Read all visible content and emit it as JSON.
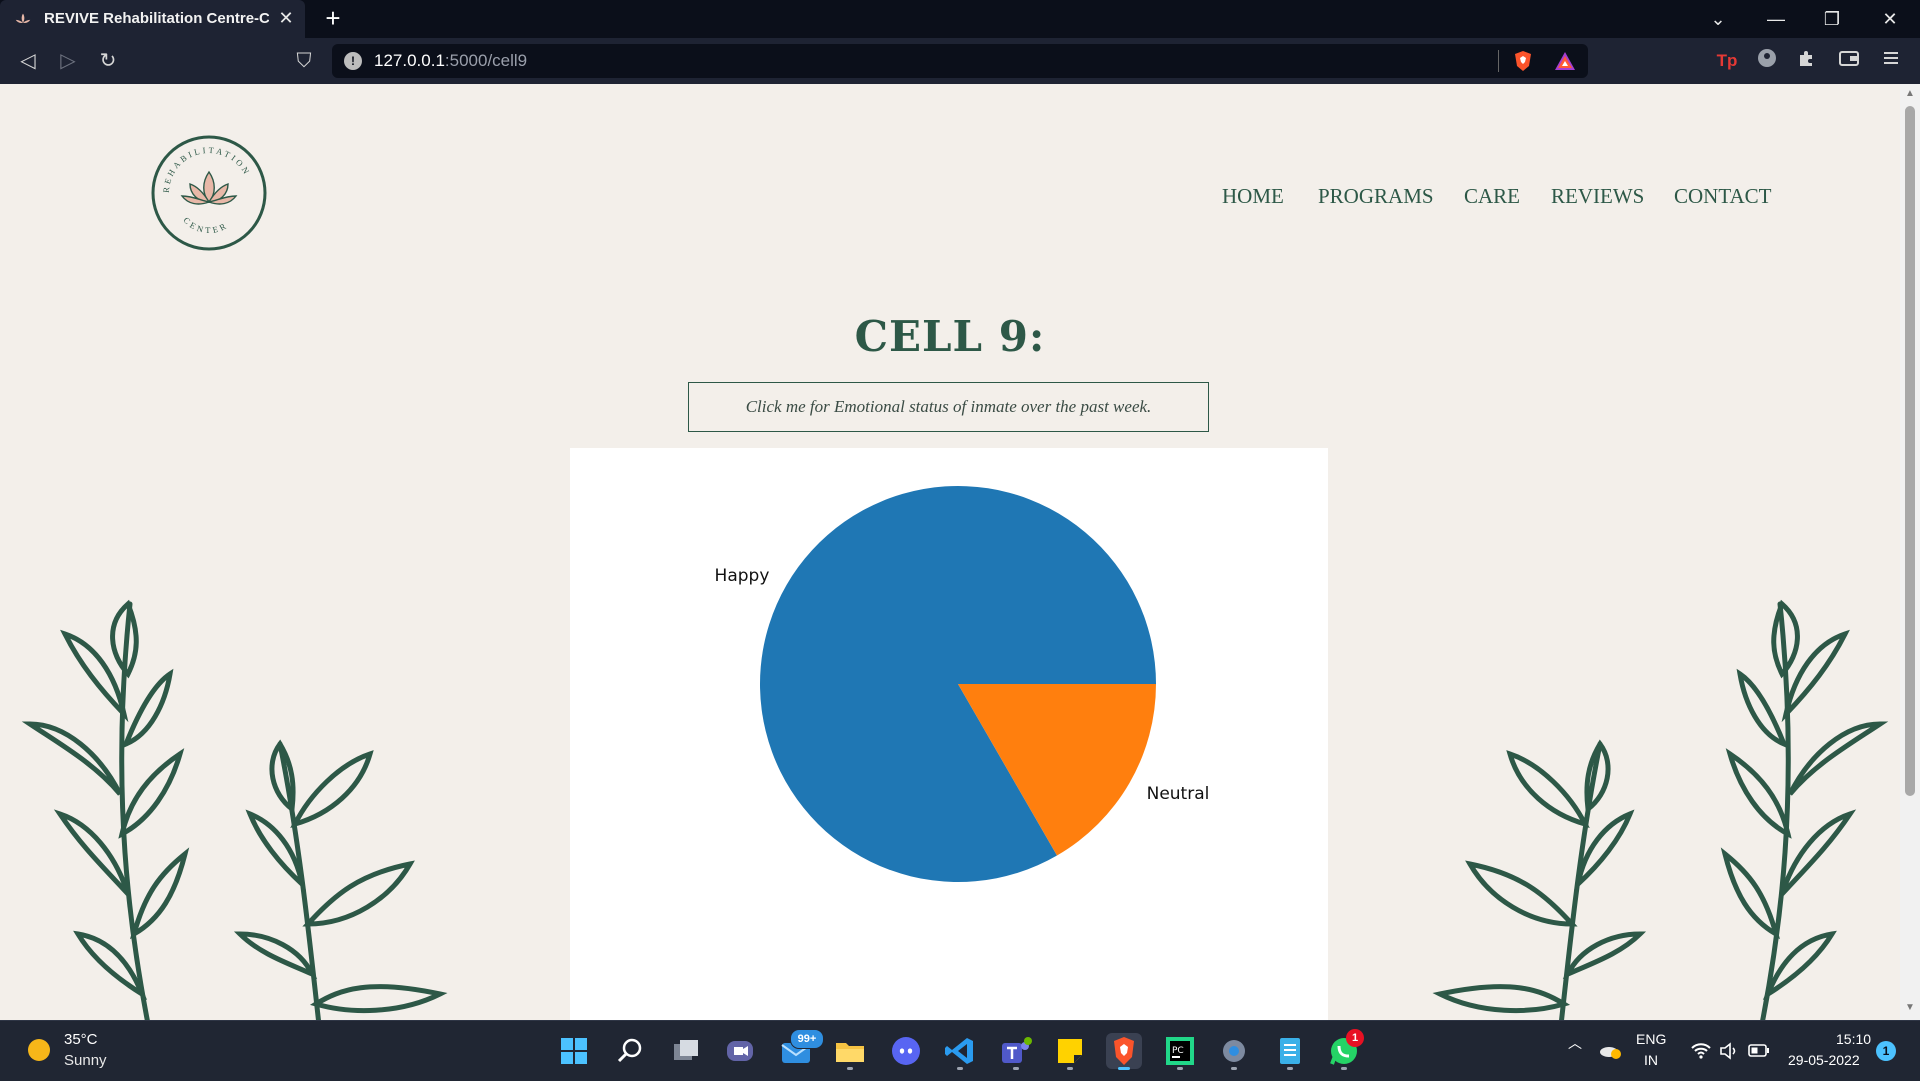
{
  "browser": {
    "tab_title": "REVIVE Rehabilitation Centre-CEL",
    "tab_close": "✕",
    "new_tab": "+",
    "url_host": "127.0.0.1",
    "url_path": ":5000/cell9",
    "url_info": "!",
    "win_dropdown": "⌄",
    "win_minimize": "—",
    "win_restore": "❐",
    "win_close": "✕",
    "back": "◁",
    "forward": "▷",
    "reload": "↻",
    "bookmark": "⛉"
  },
  "site": {
    "logo": {
      "ring_text_top": "REHABILITATION",
      "ring_text_bottom": "CENTER"
    },
    "nav": [
      "HOME",
      "PROGRAMS",
      "CARE",
      "REVIEWS",
      "CONTACT"
    ],
    "page_title": "CELL 9:",
    "status_button": "Click me for Emotional status of inmate over the past week."
  },
  "chart_data": {
    "type": "pie",
    "labels": [
      "Happy",
      "Neutral"
    ],
    "values": [
      5,
      1
    ],
    "colors": [
      "#1f77b4",
      "#ff7f0e"
    ],
    "title": ""
  },
  "taskbar": {
    "weather_temp": "35°C",
    "weather_cond": "Sunny",
    "mail_badge": "99+",
    "whatsapp_badge": "1",
    "lang_line1": "ENG",
    "lang_line2": "IN",
    "time": "15:10",
    "date": "29-05-2022",
    "notifications": "1"
  },
  "colors": {
    "page_bg": "#f3efea",
    "brand_green": "#2d5847",
    "logo_pink": "#e8b8a8"
  }
}
